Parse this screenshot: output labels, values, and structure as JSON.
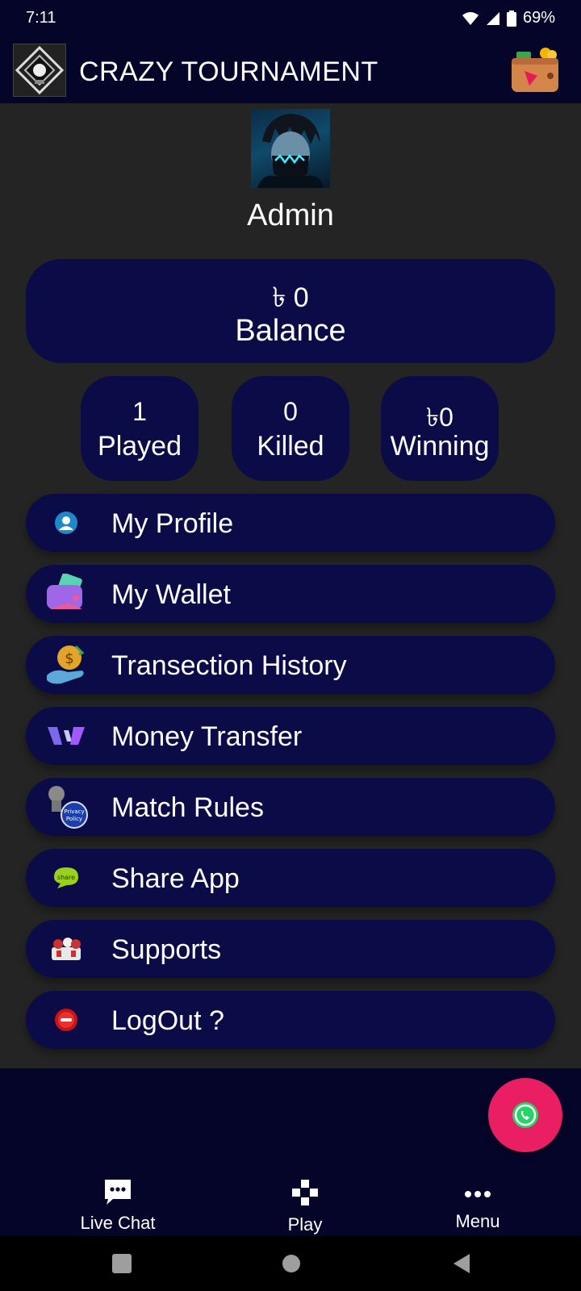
{
  "status_bar": {
    "time": "7:11",
    "battery": "69%"
  },
  "app_bar": {
    "title": "CRAZY TOURNAMENT",
    "logo_icon": "shield-logo-icon",
    "wallet_icon": "wallet-icon"
  },
  "profile": {
    "name": "Admin",
    "avatar_icon": "masked-avatar"
  },
  "balance": {
    "amount": "৳ 0",
    "label": "Balance"
  },
  "stats": [
    {
      "value": "1",
      "label": "Played"
    },
    {
      "value": "0",
      "label": "Killed"
    },
    {
      "value": "৳0",
      "label": "Winning"
    }
  ],
  "menu": [
    {
      "label": "My Profile",
      "icon": "profile-icon"
    },
    {
      "label": "My Wallet",
      "icon": "wallet-icon"
    },
    {
      "label": "Transection History",
      "icon": "money-hand-icon"
    },
    {
      "label": "Money Transfer",
      "icon": "transfer-icon"
    },
    {
      "label": "Match Rules",
      "icon": "privacy-policy-icon"
    },
    {
      "label": "Share App",
      "icon": "share-icon"
    },
    {
      "label": "Supports",
      "icon": "support-icon"
    },
    {
      "label": "LogOut ?",
      "icon": "logout-icon"
    }
  ],
  "fab": {
    "icon": "whatsapp-icon"
  },
  "bottom_nav": [
    {
      "label": "Live Chat",
      "icon": "chat-icon"
    },
    {
      "label": "Play",
      "icon": "gamepad-icon"
    },
    {
      "label": "Menu",
      "icon": "more-icon"
    }
  ],
  "colors": {
    "background": "#05052a",
    "content": "#242424",
    "card": "#0b0b48",
    "fab": "#e91e63"
  }
}
